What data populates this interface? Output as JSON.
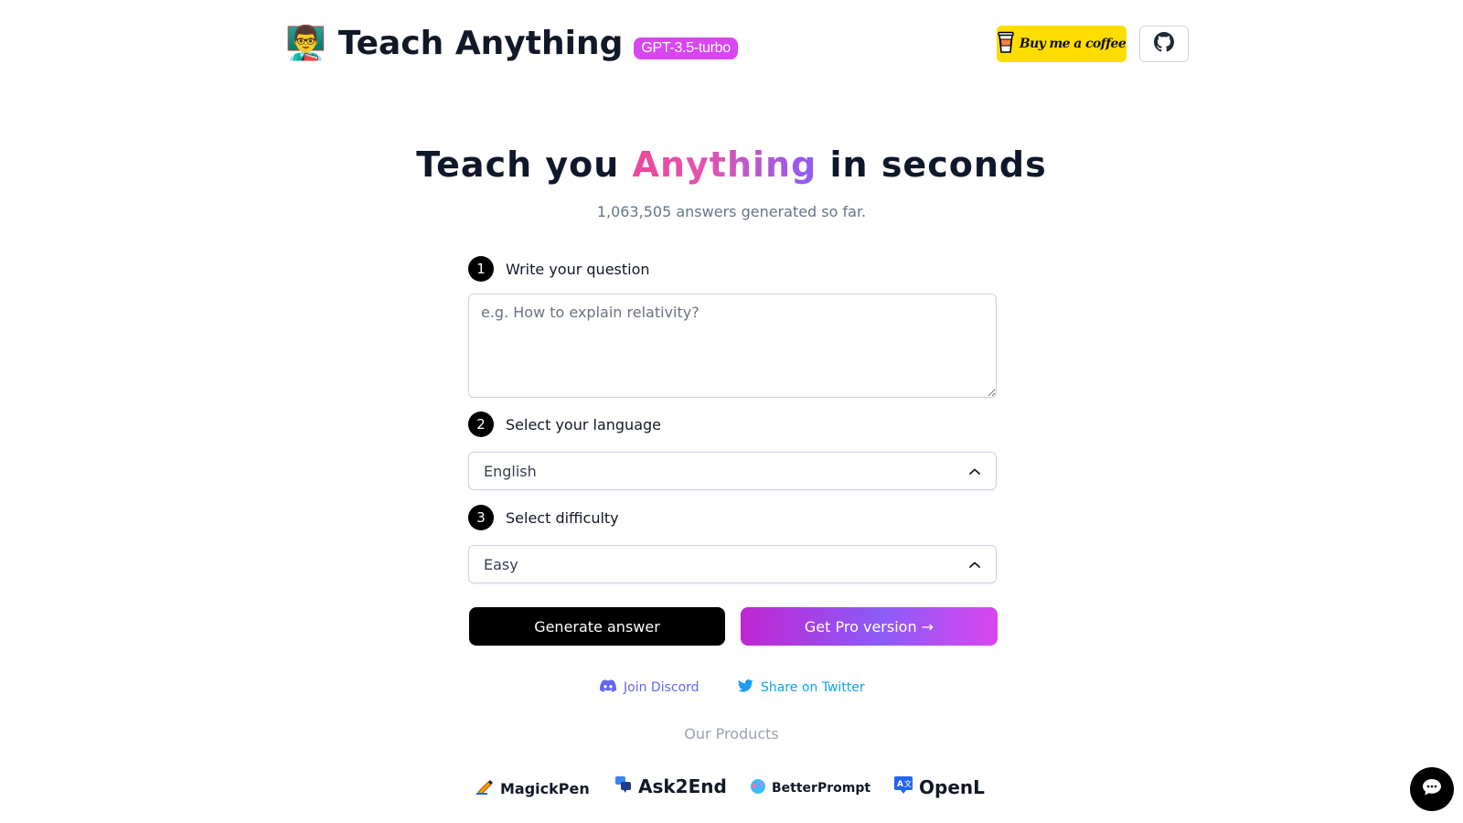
{
  "header": {
    "emoji": "👨‍🏫",
    "title": "Teach Anything",
    "model_badge": "GPT-3.5-turbo",
    "coffee_label": "Buy me a coffee",
    "github_icon": "github-icon"
  },
  "hero": {
    "title_before": "Teach you ",
    "title_highlight": "Anything",
    "title_after": " in seconds",
    "subtitle": "1,063,505 answers generated so far."
  },
  "form": {
    "step1": {
      "number": "1",
      "label": "Write your question"
    },
    "question_placeholder": "e.g. How to explain relativity?",
    "question_value": "",
    "step2": {
      "number": "2",
      "label": "Select your language"
    },
    "language_value": "English",
    "step3": {
      "number": "3",
      "label": "Select difficulty"
    },
    "difficulty_value": "Easy",
    "generate_label": "Generate answer",
    "pro_label": "Get Pro version →"
  },
  "social": {
    "discord_label": "Join Discord",
    "twitter_label": "Share on Twitter"
  },
  "products": {
    "title": "Our Products",
    "items": [
      "MagickPen",
      "Ask2End",
      "BetterPrompt",
      "OpenL"
    ]
  },
  "colors": {
    "badge": "#d946ef",
    "coffee": "#ffdd00",
    "discord": "#6366f1",
    "twitter": "#0ea5e9",
    "accent_gradient_start": "#ec4899",
    "accent_gradient_end": "#8b5cf6"
  }
}
